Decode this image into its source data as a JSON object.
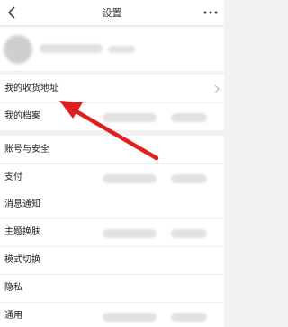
{
  "header": {
    "title": "设置",
    "back_icon": "back-chevron-icon",
    "more_icon": "more-dots-icon"
  },
  "profile": {
    "avatar_icon": "avatar-blurred"
  },
  "sections": [
    {
      "items": [
        {
          "label": "我的收货地址"
        },
        {
          "label": "我的档案"
        }
      ]
    },
    {
      "items": [
        {
          "label": "账号与安全"
        },
        {
          "label": "支付"
        }
      ]
    },
    {
      "items": [
        {
          "label": "消息通知"
        },
        {
          "label": "主题换肤"
        },
        {
          "label": "模式切换"
        },
        {
          "label": "隐私"
        },
        {
          "label": "通用"
        }
      ]
    }
  ],
  "annotation": {
    "arrow_color": "#e11f1f",
    "arrow_icon": "red-arrow-pointer"
  }
}
